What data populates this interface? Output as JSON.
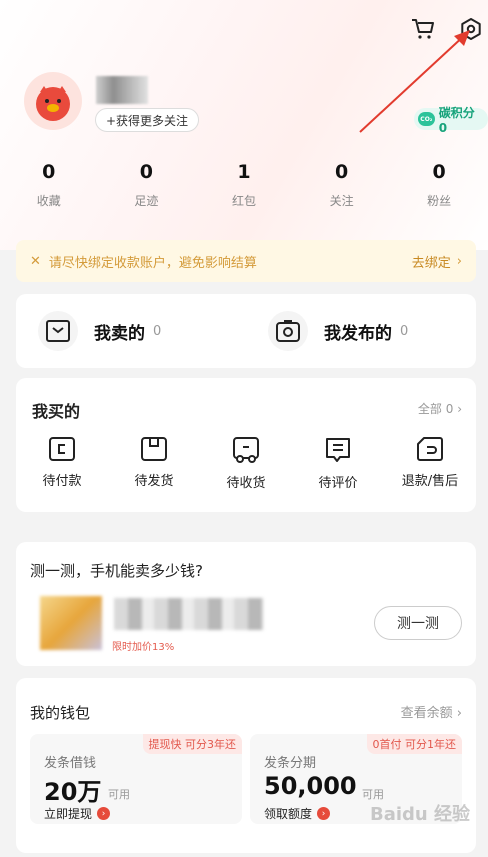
{
  "header": {
    "cart_icon": "cart-icon",
    "settings_icon": "settings-icon",
    "follow_button_label": "+获得更多关注",
    "carbon_badge": "CO₂",
    "carbon_label": "碳积分0"
  },
  "stats": [
    {
      "value": "0",
      "label": "收藏"
    },
    {
      "value": "0",
      "label": "足迹"
    },
    {
      "value": "1",
      "label": "红包"
    },
    {
      "value": "0",
      "label": "关注"
    },
    {
      "value": "0",
      "label": "粉丝"
    }
  ],
  "notice": {
    "text": "请尽快绑定收款账户，避免影响结算",
    "action": "去绑定"
  },
  "sell": {
    "sold_label": "我卖的",
    "sold_count": "0",
    "published_label": "我发布的",
    "published_count": "0"
  },
  "buy": {
    "title": "我买的",
    "all_label": "全部 0",
    "items": [
      {
        "label": "待付款",
        "icon": "wallet-card-icon"
      },
      {
        "label": "待发货",
        "icon": "package-icon"
      },
      {
        "label": "待收货",
        "icon": "truck-icon"
      },
      {
        "label": "待评价",
        "icon": "comment-icon"
      },
      {
        "label": "退款/售后",
        "icon": "refund-icon"
      }
    ]
  },
  "phone_test": {
    "title": "测一测，手机能卖多少钱?",
    "red_text": "限时加价13%",
    "button_label": "测一测"
  },
  "wallet": {
    "title": "我的钱包",
    "balance_link": "查看余额",
    "loan": {
      "tag": "提现快 可分3年还",
      "label": "发条借钱",
      "amount": "20万",
      "unit": "可用",
      "link": "立即提现"
    },
    "installment": {
      "tag": "0首付 可分1年还",
      "label": "发条分期",
      "amount": "50,000",
      "unit": "可用",
      "link": "领取额度"
    }
  },
  "watermark": "Baidu 经验",
  "colors": {
    "accent_red": "#e64b3b",
    "carbon_green": "#17a37b",
    "notice_text": "#d49b3a"
  }
}
